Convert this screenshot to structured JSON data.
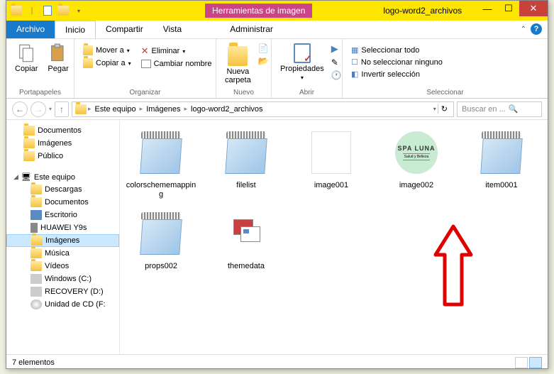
{
  "titlebar": {
    "context_tab": "Herramientas de imagen",
    "window_title": "logo-word2_archivos"
  },
  "menubar": {
    "file": "Archivo",
    "tabs": [
      "Inicio",
      "Compartir",
      "Vista"
    ],
    "manage": "Administrar"
  },
  "ribbon": {
    "clipboard": {
      "copy": "Copiar",
      "paste": "Pegar",
      "label": "Portapapeles"
    },
    "organize": {
      "move": "Mover a",
      "copy_to": "Copiar a",
      "delete": "Eliminar",
      "rename": "Cambiar nombre",
      "label": "Organizar"
    },
    "new": {
      "folder": "Nueva\ncarpeta",
      "label": "Nuevo"
    },
    "open": {
      "props": "Propiedades",
      "label": "Abrir"
    },
    "select": {
      "all": "Seleccionar todo",
      "none": "No seleccionar ninguno",
      "invert": "Invertir selección",
      "label": "Seleccionar"
    }
  },
  "breadcrumbs": [
    "Este equipo",
    "Imágenes",
    "logo-word2_archivos"
  ],
  "search_placeholder": "Buscar en ...",
  "navtree": {
    "fav": [
      "Documentos",
      "Imágenes",
      "Público"
    ],
    "pc": "Este equipo",
    "pc_items": [
      "Descargas",
      "Documentos",
      "Escritorio",
      "HUAWEI Y9s",
      "Imágenes",
      "Música",
      "Vídeos",
      "Windows (C:)",
      "RECOVERY (D:)",
      "Unidad de CD (F:"
    ]
  },
  "files": [
    {
      "name": "colorschememapping",
      "type": "notepad"
    },
    {
      "name": "filelist",
      "type": "notepad"
    },
    {
      "name": "image001",
      "type": "blank"
    },
    {
      "name": "image002",
      "type": "spa"
    },
    {
      "name": "item0001",
      "type": "notepad"
    },
    {
      "name": "props002",
      "type": "notepad"
    },
    {
      "name": "themedata",
      "type": "theme"
    }
  ],
  "spa": {
    "line1": "SPA LUNA",
    "line2": "Salud y Belleza"
  },
  "status": "7 elementos"
}
